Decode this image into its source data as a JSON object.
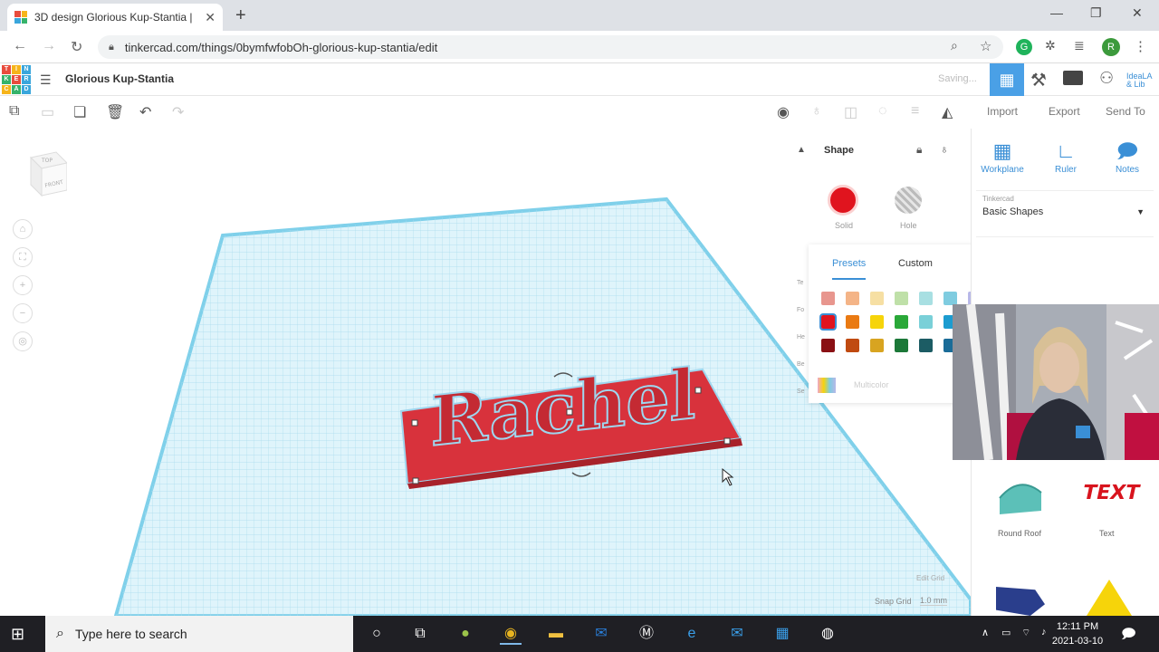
{
  "browser": {
    "tab_title": "3D design Glorious Kup-Stantia |",
    "url": "tinkercad.com/things/0bymfwfobOh-glorious-kup-stantia/edit",
    "profile_initial": "R"
  },
  "header": {
    "design_name": "Glorious Kup-Stantia",
    "status": "Saving...",
    "user_org": "IdeaLA & Lib"
  },
  "toolbar": {
    "import_label": "Import",
    "export_label": "Export",
    "sendto_label": "Send To"
  },
  "viewcube": {
    "top": "TOP",
    "front": "FRONT"
  },
  "right_tools": [
    {
      "label": "Workplane",
      "icon": "workplane-icon"
    },
    {
      "label": "Ruler",
      "icon": "ruler-icon"
    },
    {
      "label": "Notes",
      "icon": "notes-icon"
    }
  ],
  "library": {
    "source": "Tinkercad",
    "category": "Basic Shapes"
  },
  "shape_panel": {
    "title": "Shape",
    "solid_label": "Solid",
    "hole_label": "Hole",
    "solid_color": "#e0141e"
  },
  "color_popup": {
    "tab_presets": "Presets",
    "tab_custom": "Custom",
    "multicolor_label": "Multicolor",
    "side_labels": [
      "Te",
      "Fo",
      "He",
      "Be",
      "Se"
    ],
    "rows": [
      [
        "#e8968e",
        "#f4b487",
        "#f6dfa3",
        "#bfe0a8",
        "#a8dfe2",
        "#7fcce0",
        "#b8b8e8",
        "#d8b8e6",
        "#f0a8c8",
        "#f0c070",
        "#f2f2f2",
        "#c8c8c8"
      ],
      [
        "#e0141e",
        "#ea7a12",
        "#f6d40a",
        "#2aa838",
        "#7ad0d8",
        "#1c9cd0"
      ],
      [
        "#8a1014",
        "#c04a10",
        "#d8a420",
        "#1c7838",
        "#1c5c64",
        "#1a6c98"
      ]
    ],
    "selected_color": "#e0141e"
  },
  "shapes": [
    {
      "label": "Round Roof",
      "color": "#5cc0b8"
    },
    {
      "label": "Text",
      "color": "#d8141e"
    }
  ],
  "canvas": {
    "object_text": "Rachel",
    "edit_grid": "Edit Grid",
    "snap_grid_label": "Snap Grid",
    "snap_grid_value": "1.0 mm"
  },
  "taskbar": {
    "search_placeholder": "Type here to search",
    "time": "12:11 PM",
    "date": "2021-03-10"
  },
  "colors": {
    "accent": "#4aa0e6",
    "grid": "#b9e4f4",
    "object": "#d8323c"
  }
}
